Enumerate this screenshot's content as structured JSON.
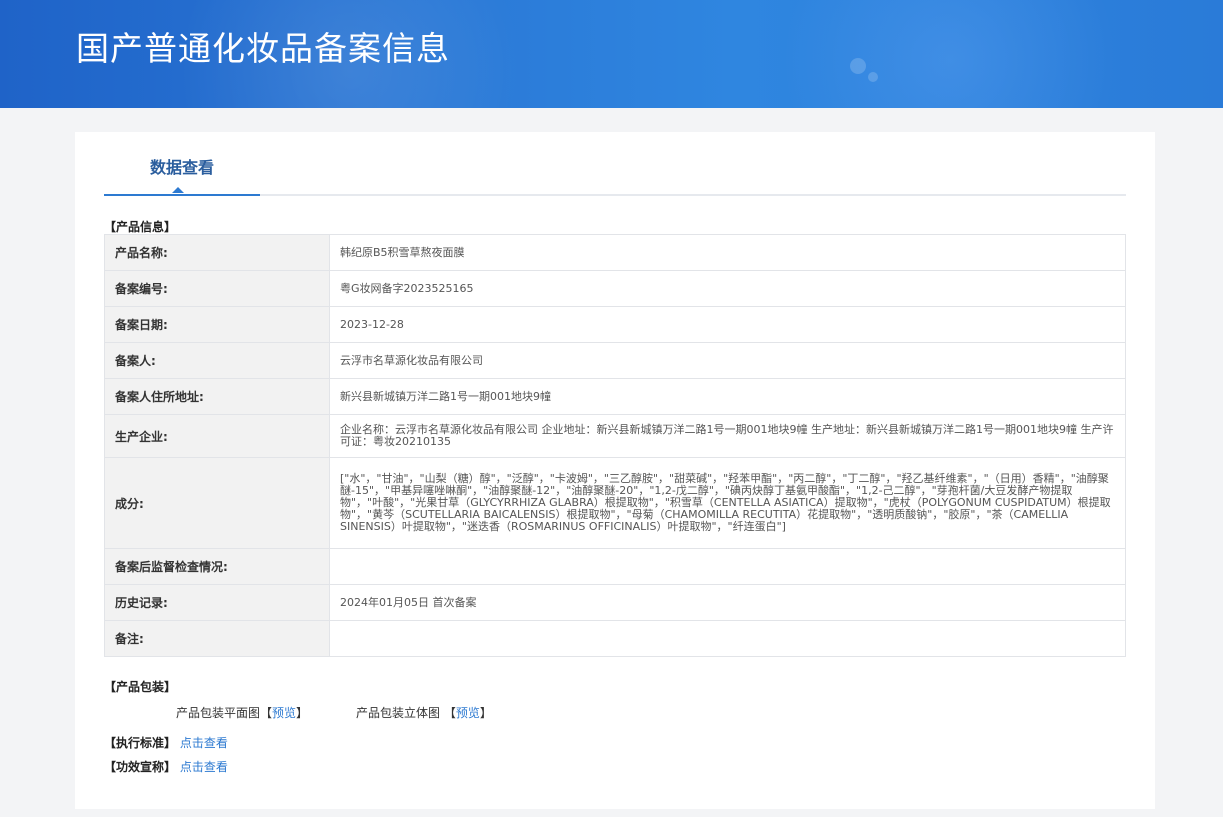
{
  "header": {
    "title": "国产普通化妆品备案信息"
  },
  "tabs": [
    {
      "label": "数据查看",
      "active": true
    }
  ],
  "product_section": {
    "title": "【产品信息】",
    "rows": [
      {
        "label": "产品名称:",
        "value": "韩纪原B5积雪草熬夜面膜"
      },
      {
        "label": "备案编号:",
        "value": "粤G妆网备字2023525165"
      },
      {
        "label": "备案日期:",
        "value": "2023-12-28"
      },
      {
        "label": "备案人:",
        "value": "云浮市名草源化妆品有限公司"
      },
      {
        "label": "备案人住所地址:",
        "value": "新兴县新城镇万洋二路1号一期001地块9幢"
      },
      {
        "label": "生产企业:",
        "value": "企业名称：云浮市名草源化妆品有限公司 企业地址：新兴县新城镇万洋二路1号一期001地块9幢 生产地址：新兴县新城镇万洋二路1号一期001地块9幢 生产许可证：粤妆20210135"
      },
      {
        "label": "成分:",
        "value": "[\"水\"，\"甘油\"，\"山梨（糖）醇\"，\"泛醇\"，\"卡波姆\"，\"三乙醇胺\"，\"甜菜碱\"，\"羟苯甲酯\"，\"丙二醇\"，\"丁二醇\"，\"羟乙基纤维素\"，\"（日用）香精\"，\"油醇聚醚-15\"，\"甲基异噻唑啉酮\"，\"油醇聚醚-12\"，\"油醇聚醚-20\"，\"1,2-戊二醇\"，\"碘丙炔醇丁基氨甲酸酯\"，\"1,2-己二醇\"，\"芽孢杆菌/大豆发酵产物提取物\"，\"叶酸\"，\"光果甘草（GLYCYRRHIZA GLABRA）根提取物\"，\"积雪草（CENTELLA ASIATICA）提取物\"，\"虎杖（POLYGONUM CUSPIDATUM）根提取物\"，\"黄芩（SCUTELLARIA BAICALENSIS）根提取物\"，\"母菊（CHAMOMILLA RECUTITA）花提取物\"，\"透明质酸钠\"，\"胶原\"，\"茶（CAMELLIA SINENSIS）叶提取物\"，\"迷迭香（ROSMARINUS OFFICINALIS）叶提取物\"，\"纤连蛋白\"]"
      },
      {
        "label": "备案后监督检查情况:",
        "value": ""
      },
      {
        "label": "历史记录:",
        "value": "2024年01月05日 首次备案"
      },
      {
        "label": "备注:",
        "value": ""
      }
    ]
  },
  "package_section": {
    "title": "【产品包装】",
    "flat_label": "产品包装平面图",
    "solid_label": "产品包装立体图",
    "bracket_open": "【",
    "bracket_close": "】",
    "preview_label": "预览"
  },
  "standard": {
    "title": "【执行标准】",
    "link": "点击查看"
  },
  "efficacy": {
    "title": "【功效宣称】",
    "link": "点击查看"
  }
}
